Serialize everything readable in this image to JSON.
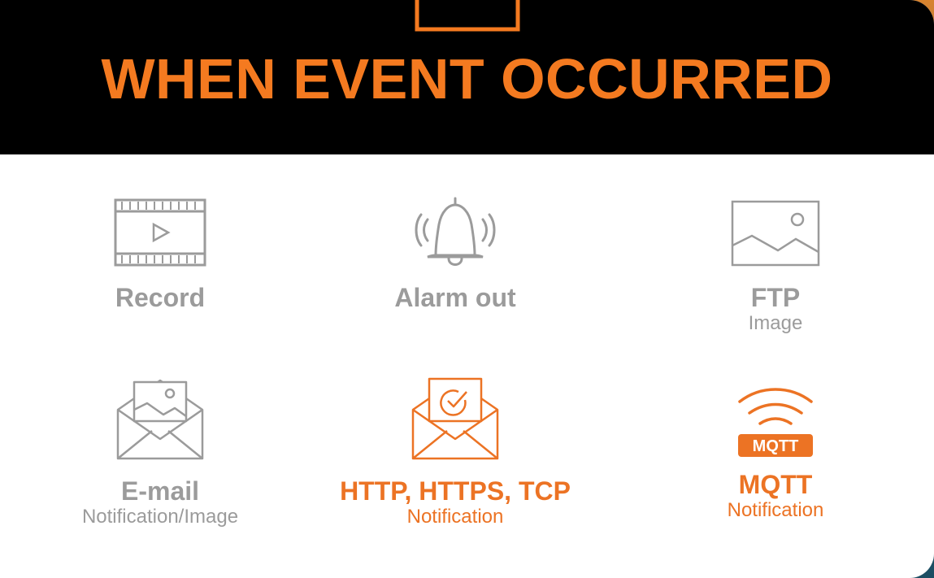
{
  "header": {
    "title": "WHEN EVENT OCCURRED"
  },
  "colors": {
    "accent": "#f47a20",
    "muted": "#9b9b9b",
    "header_bg": "#000000"
  },
  "actions": [
    {
      "label": "Record",
      "sub": "",
      "icon": "video-film-icon",
      "active": false
    },
    {
      "label": "Alarm out",
      "sub": "",
      "icon": "bell-alarm-icon",
      "active": false
    },
    {
      "label": "FTP",
      "sub": "Image",
      "icon": "image-icon",
      "active": false
    },
    {
      "label": "E-mail",
      "sub": "Notification/Image",
      "icon": "email-image-icon",
      "active": false
    },
    {
      "label": "HTTP, HTTPS, TCP",
      "sub": "Notification",
      "icon": "email-check-icon",
      "active": true
    },
    {
      "label": "MQTT",
      "sub": "Notification",
      "icon": "mqtt-wifi-icon",
      "badge": "MQTT",
      "active": true
    }
  ]
}
